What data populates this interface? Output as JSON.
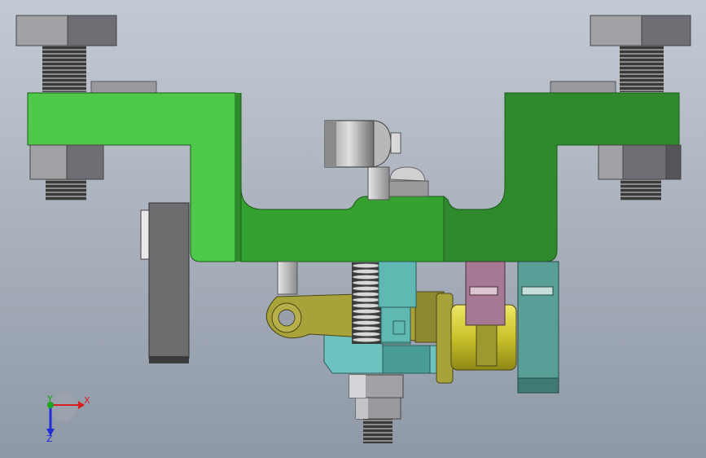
{
  "viewport": {
    "background_top": "#c4cad3",
    "background_bottom": "#8e98a6"
  },
  "axis_triad": {
    "x_label": "X",
    "y_label": "Y",
    "z_label": "Z",
    "x_color": "#d81e1e",
    "y_color": "#1ea31e",
    "z_color": "#1e2ed8"
  },
  "part_colors": {
    "bracket_light": "#4ec94a",
    "bracket_mid": "#35a131",
    "bracket_dark": "#2e8a2c",
    "bolt_head_light": "#9a9a9e",
    "bolt_head_dark": "#6e6e74",
    "gray_plate": "#6d6d70",
    "lever_olive": "#a8a23a",
    "yellow_cylinder": "#c9c32a",
    "cyan_block": "#6ec3c0",
    "teal_shaft": "#5fb9b2",
    "pink_block": "#a57893",
    "teal_stop": "#5a9e98"
  }
}
